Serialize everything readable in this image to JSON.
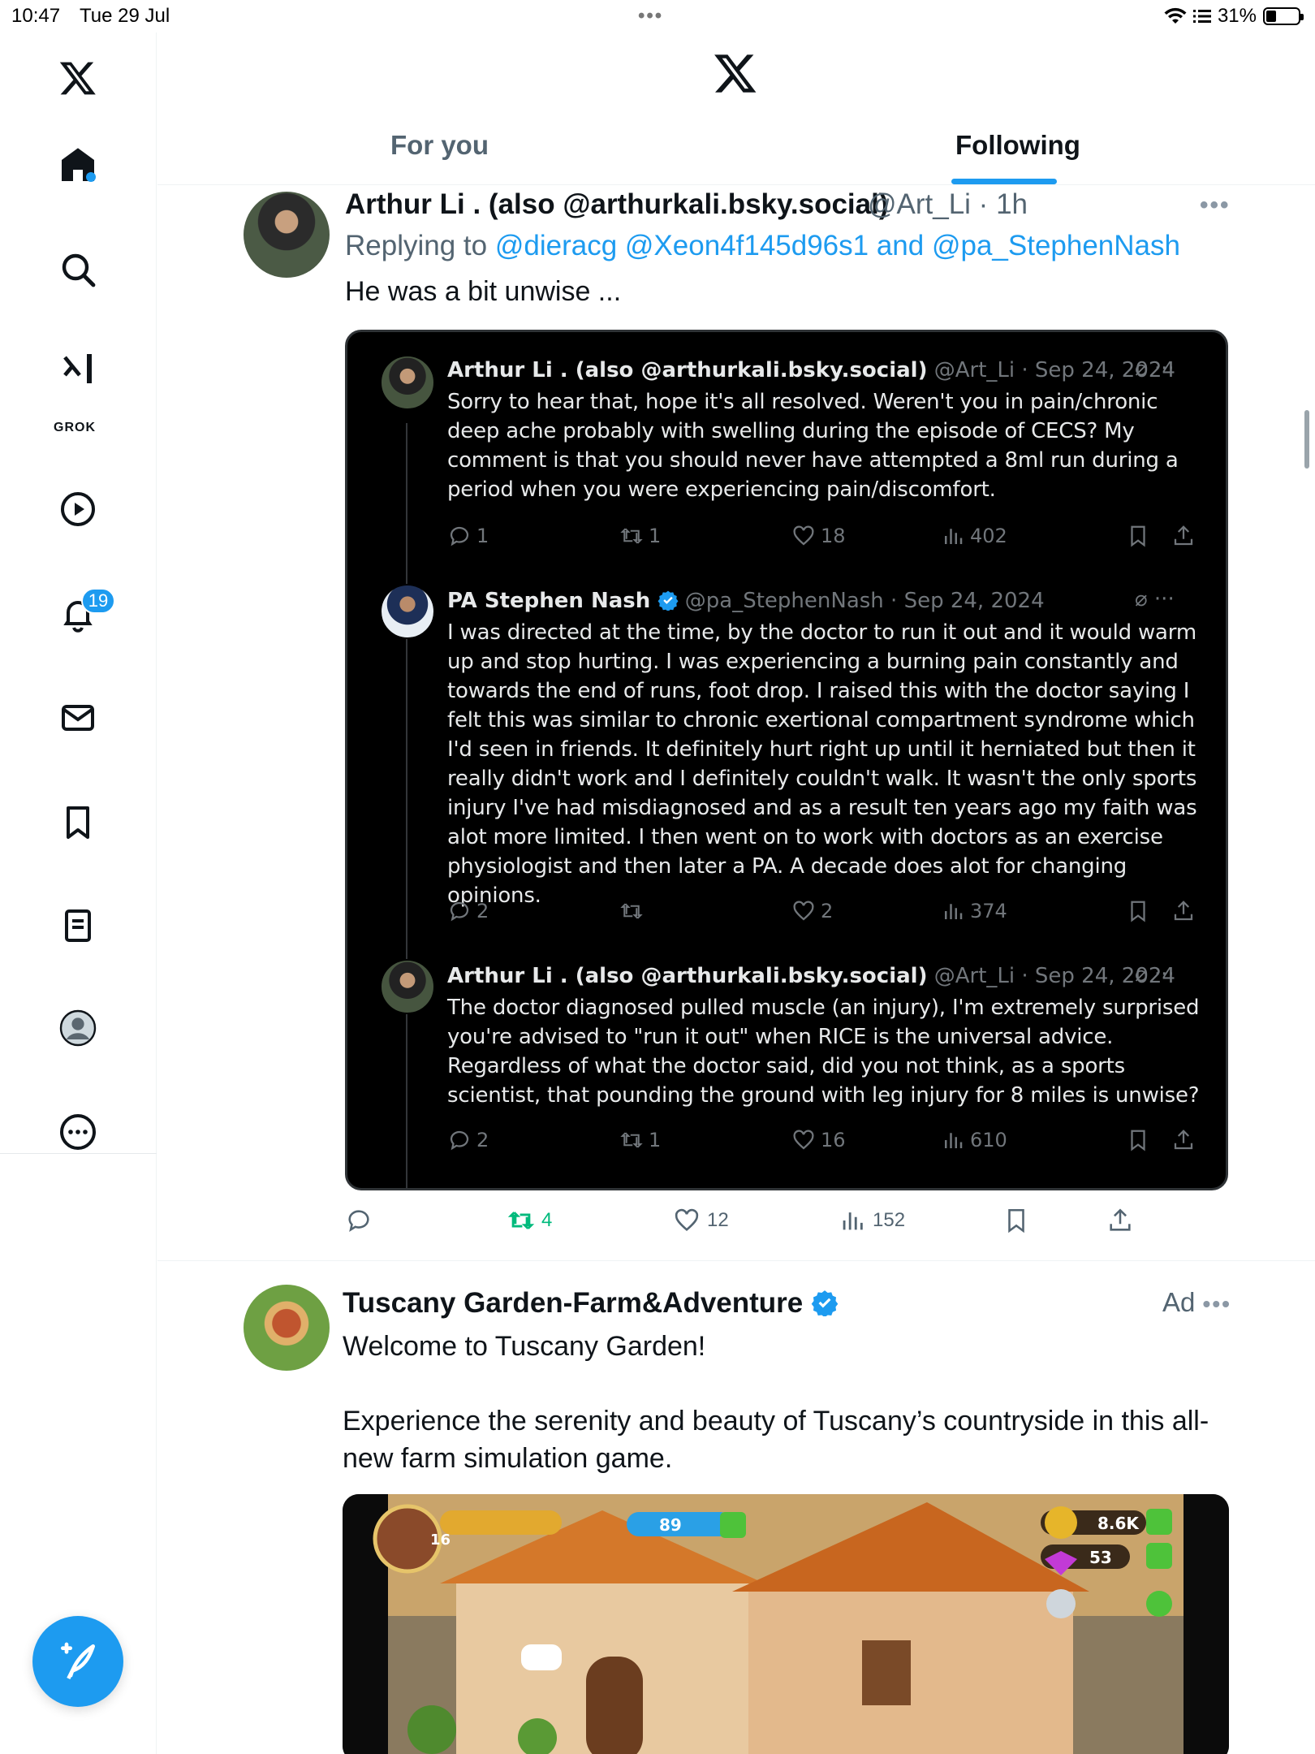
{
  "status_bar": {
    "time": "10:47",
    "date": "Tue 29 Jul",
    "battery": "31%",
    "battery_level": 0.31
  },
  "sidebar": {
    "items": [
      {
        "name": "home",
        "icon": "home-icon"
      },
      {
        "name": "explore",
        "icon": "search-icon"
      },
      {
        "name": "grok",
        "icon": "grok-icon",
        "label": "GROK"
      },
      {
        "name": "video",
        "icon": "play-icon"
      },
      {
        "name": "notifications",
        "icon": "bell-icon",
        "badge": "19"
      },
      {
        "name": "messages",
        "icon": "mail-icon"
      },
      {
        "name": "bookmarks",
        "icon": "bookmark-icon"
      },
      {
        "name": "lists",
        "icon": "list-icon"
      },
      {
        "name": "profile",
        "icon": "avatar-icon"
      },
      {
        "name": "more",
        "icon": "more-icon"
      }
    ],
    "compose_icon": "compose-icon"
  },
  "header": {
    "tabs": [
      {
        "label": "For you"
      },
      {
        "label": "Following",
        "active": true
      }
    ]
  },
  "tweet1": {
    "author_name": "Arthur Li . (also @arthurkali.bsky.social)",
    "handle_time": "@Art_Li · 1h",
    "reply_prefix": "Replying to",
    "reply_mentions": "@dieracg @Xeon4f145d96s1 and @pa_StephenNash",
    "text": "He was a bit unwise ...",
    "embedded": [
      {
        "name": "Arthur Li . (also @arthurkali.bsky.social)",
        "meta": "@Art_Li · Sep 24, 2024",
        "verified": false,
        "text": "Sorry to hear that, hope it's all resolved. Weren't you in pain/chronic deep ache probably with swelling during the episode of CECS? My comment is that you should never have attempted a 8ml run during a period when you were experiencing pain/discomfort.",
        "replies": "1",
        "reposts": "1",
        "likes": "18",
        "views": "402"
      },
      {
        "name": "PA Stephen Nash",
        "meta": "@pa_StephenNash · Sep 24, 2024",
        "verified": true,
        "text": "I was directed at the time, by the doctor to run it out and it would warm up and stop hurting. I was experiencing a burning pain constantly and towards the end of runs, foot drop. I raised this with the doctor saying I felt this was similar to chronic exertional compartment syndrome which I'd seen in friends. It definitely hurt right up until it herniated but then it really didn't work and I definitely couldn't walk. It wasn't the only sports injury I've had misdiagnosed and as a result ten years ago my faith was alot more limited. I then went on to work with doctors as an exercise physiologist and then later a PA. A decade does alot for changing opinions.",
        "replies": "2",
        "reposts": "",
        "likes": "2",
        "views": "374"
      },
      {
        "name": "Arthur Li . (also @arthurkali.bsky.social)",
        "meta": "@Art_Li · Sep 24, 2024",
        "verified": false,
        "text": "The doctor diagnosed pulled muscle (an injury), I'm extremely surprised you're advised to \"run it out\" when RICE is the universal advice. Regardless of what the doctor said, did you not think, as a sports scientist, that pounding the ground with leg injury for 8 miles is unwise?",
        "replies": "2",
        "reposts": "1",
        "likes": "16",
        "views": "610"
      }
    ],
    "actions": {
      "replies": "",
      "reposts": "4",
      "likes": "12",
      "views": "152"
    },
    "colors": {
      "repost_active": "#00ba7c"
    }
  },
  "tweet2": {
    "author_name": "Tuscany Garden-Farm&Adventure",
    "ad_label": "Ad",
    "text_line1": "Welcome to Tuscany Garden!",
    "text_line2": "Experience the serenity and beauty of Tuscany’s countryside in this all-new farm simulation game.",
    "game_hud": {
      "level": "16",
      "energy": "89",
      "coins": "8.6K",
      "gems": "53"
    }
  },
  "colors": {
    "accent": "#1d9bf0",
    "text": "#0f1419",
    "muted": "#536471"
  }
}
